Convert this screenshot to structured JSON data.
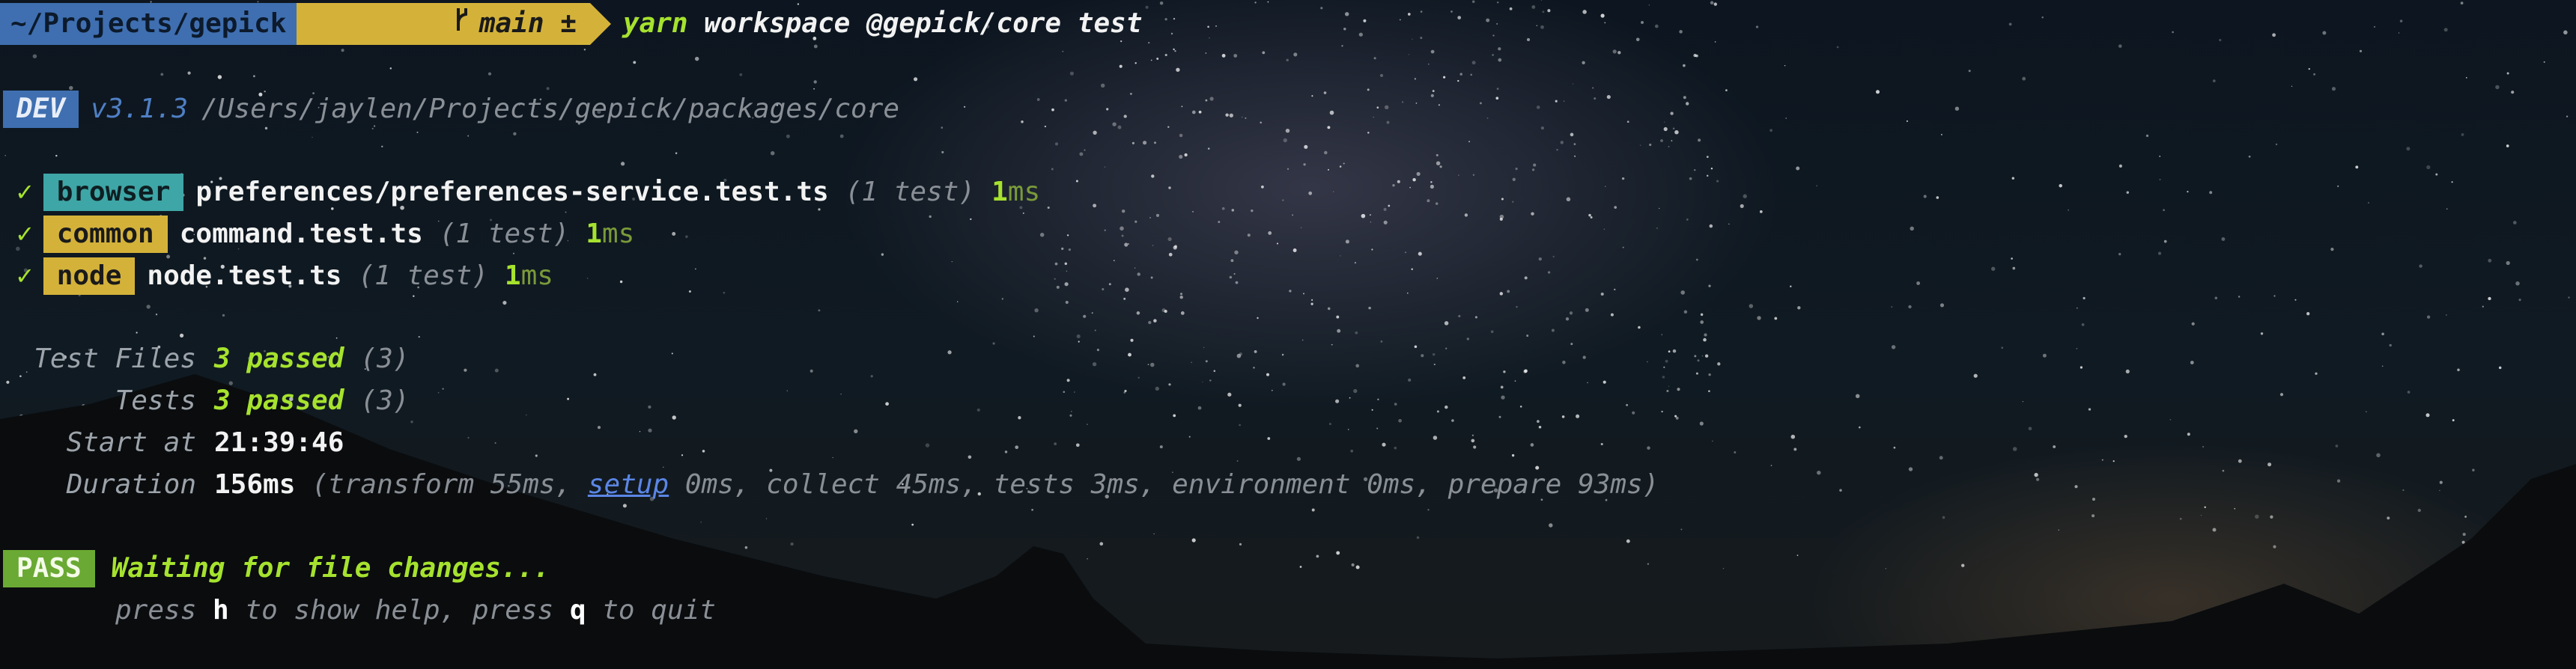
{
  "prompt": {
    "path": "~/Projects/gepick",
    "git_branch": "main ±",
    "command_tool": "yarn",
    "command_args": " workspace @gepick/core test"
  },
  "header": {
    "badge": "DEV",
    "version": "v3.1.3",
    "path": "/Users/jaylen/Projects/gepick/packages/core"
  },
  "results": [
    {
      "check": "✓",
      "project": "browser",
      "project_color": "#3ea6a6",
      "file": "preferences/preferences-service.test.ts",
      "count": "(1 test)",
      "time_num": "1",
      "time_unit": "ms"
    },
    {
      "check": "✓",
      "project": "common",
      "project_color": "#d4b23a",
      "file": "command.test.ts",
      "count": "(1 test)",
      "time_num": "1",
      "time_unit": "ms"
    },
    {
      "check": "✓",
      "project": "node",
      "project_color": "#d4b23a",
      "file": "node.test.ts",
      "count": "(1 test)",
      "time_num": "1",
      "time_unit": "ms"
    }
  ],
  "summary": {
    "test_files": {
      "label": "Test Files",
      "passed": "3 passed",
      "total": "(3)"
    },
    "tests": {
      "label": "Tests",
      "passed": "3 passed",
      "total": "(3)"
    },
    "start_at": {
      "label": "Start at",
      "value": "21:39:46"
    },
    "duration": {
      "label": "Duration",
      "value": "156ms",
      "detail_pre": "(transform 55ms, ",
      "detail_link": "setup",
      "detail_post": " 0ms, collect 45ms, tests 3ms, environment 0ms, prepare 93ms)"
    }
  },
  "status": {
    "badge": "PASS",
    "message": "Waiting for file changes...",
    "help_1": "press ",
    "help_key_1": "h",
    "help_2": " to show help, press ",
    "help_key_2": "q",
    "help_3": " to quit"
  },
  "colors": {
    "path_segment": "#3f6fb0",
    "branch_segment": "#d4b23a",
    "dev_badge": "#3f6fb0",
    "pass_badge": "#6aa933",
    "pass_text": "#a6e22e",
    "link": "#5b86e5"
  }
}
